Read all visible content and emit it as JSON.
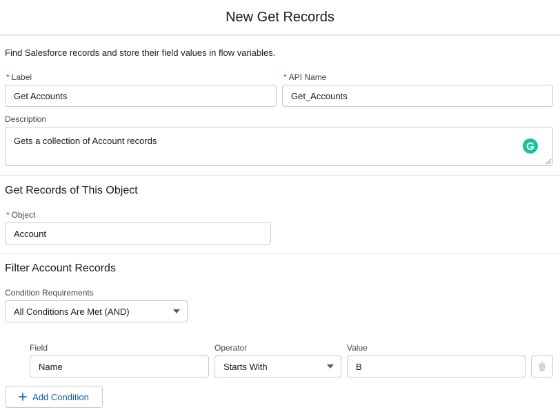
{
  "modal": {
    "title": "New Get Records"
  },
  "intro": "Find Salesforce records and store their field values in flow variables.",
  "required_marker": "*",
  "label_field": {
    "label": "Label",
    "value": "Get Accounts"
  },
  "api_name_field": {
    "label": "API Name",
    "value": "Get_Accounts"
  },
  "description_field": {
    "label": "Description",
    "value": "Gets a collection of Account records"
  },
  "object_section": {
    "title": "Get Records of This Object",
    "object_label": "Object",
    "object_value": "Account"
  },
  "filter_section": {
    "title": "Filter Account Records",
    "condition_requirements_label": "Condition Requirements",
    "condition_requirements_value": "All Conditions Are Met (AND)",
    "columns": {
      "field": "Field",
      "operator": "Operator",
      "value": "Value"
    },
    "condition": {
      "field": "Name",
      "operator": "Starts With",
      "value": "B"
    },
    "add_condition_label": "Add Condition"
  },
  "icons": {
    "grammarly": "grammarly-icon",
    "resize": "resize-handle-icon",
    "dropdown": "chevron-down-icon",
    "delete": "trash-icon",
    "add": "plus-icon"
  },
  "colors": {
    "required": "#c23934",
    "link": "#0b5cab",
    "grammarly": "#15c39a",
    "border": "#c9c9c9",
    "divider": "#e5e5e5"
  }
}
